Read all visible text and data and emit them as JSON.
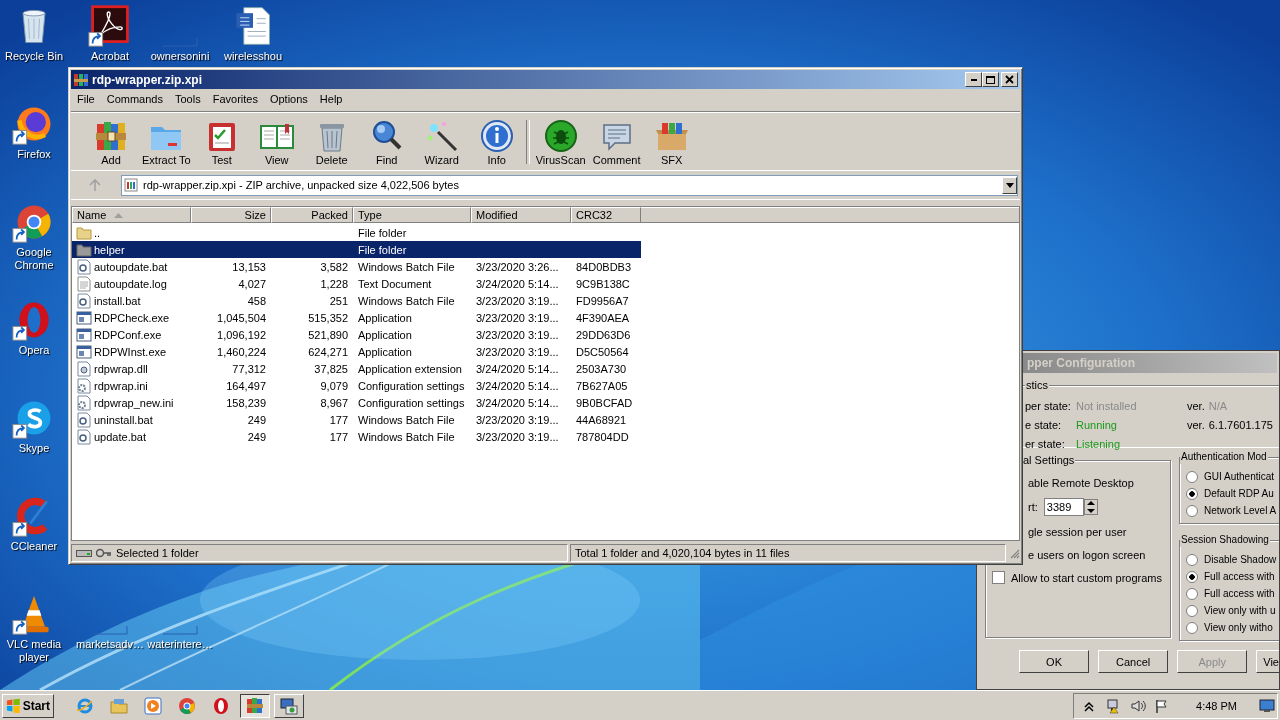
{
  "desktop": {
    "icons": [
      {
        "label": "Recycle Bin",
        "kind": "recycle",
        "shortcut": false
      },
      {
        "label": "Acrobat",
        "kind": "acrobat",
        "shortcut": true
      },
      {
        "label": "ownersonini",
        "kind": "blank",
        "shortcut": false
      },
      {
        "label": "wirelesshou",
        "kind": "word",
        "shortcut": false
      },
      {
        "label": "Firefox",
        "kind": "firefox",
        "shortcut": true
      },
      {
        "label": "Google Chrome",
        "kind": "chrome",
        "shortcut": true
      },
      {
        "label": "Opera",
        "kind": "opera",
        "shortcut": true
      },
      {
        "label": "Skype",
        "kind": "skype",
        "shortcut": true
      },
      {
        "label": "CCleaner",
        "kind": "ccleaner",
        "shortcut": true
      },
      {
        "label": "VLC media player",
        "kind": "vlc",
        "shortcut": true
      },
      {
        "label": "marketsadv…",
        "kind": "blank",
        "shortcut": false
      },
      {
        "label": "waterintere…",
        "kind": "blank",
        "shortcut": false
      }
    ]
  },
  "config_window": {
    "title": "pper Configuration",
    "diagnostics": {
      "legend": "stics",
      "rows": [
        {
          "label": "per state:",
          "value": "Not installed",
          "color": "#8a8a8a",
          "version_label": "ver.",
          "version": "N/A",
          "version_dimmed": true
        },
        {
          "label": "e state:",
          "value": "Running",
          "color": "#1a9a1a",
          "version_label": "ver.",
          "version": "6.1.7601.175",
          "version_dimmed": false
        },
        {
          "label": "er state:",
          "value": "Listening",
          "color": "#1a9a1a"
        }
      ]
    },
    "general": {
      "legend": "al Settings",
      "items": [
        {
          "kind": "text",
          "label": "able Remote Desktop"
        },
        {
          "kind": "port",
          "label": "rt:",
          "value": "3389"
        },
        {
          "kind": "text",
          "label": "gle session per user"
        },
        {
          "kind": "text",
          "label": "e users on logon screen"
        },
        {
          "kind": "checkbox",
          "label": "Allow to start custom programs",
          "checked": false
        }
      ]
    },
    "authentication": {
      "legend": "Authentication Mod",
      "options": [
        {
          "label": "GUI Authenticat",
          "selected": false
        },
        {
          "label": "Default RDP Au",
          "selected": true
        },
        {
          "label": "Network Level A",
          "selected": false
        }
      ]
    },
    "shadowing": {
      "legend": "Session Shadowing",
      "options": [
        {
          "label": "Disable Shadow",
          "selected": false
        },
        {
          "label": "Full access with",
          "selected": true
        },
        {
          "label": "Full access with",
          "selected": false
        },
        {
          "label": "View only with u",
          "selected": false
        },
        {
          "label": "View only witho",
          "selected": false
        }
      ]
    },
    "buttons": [
      {
        "label": "OK",
        "disabled": false
      },
      {
        "label": "Cancel",
        "disabled": false
      },
      {
        "label": "Apply",
        "disabled": true
      },
      {
        "label": "Vie",
        "disabled": false
      }
    ]
  },
  "archiver_window": {
    "title": "rdp-wrapper.zip.xpi",
    "menu": [
      "File",
      "Commands",
      "Tools",
      "Favorites",
      "Options",
      "Help"
    ],
    "toolbar": [
      {
        "label": "Add",
        "kind": "add",
        "separator": false
      },
      {
        "label": "Extract To",
        "kind": "extract",
        "separator": false
      },
      {
        "label": "Test",
        "kind": "test",
        "separator": false
      },
      {
        "label": "View",
        "kind": "view",
        "separator": false
      },
      {
        "label": "Delete",
        "kind": "delete",
        "separator": false
      },
      {
        "label": "Find",
        "kind": "find",
        "separator": false
      },
      {
        "label": "Wizard",
        "kind": "wizard",
        "separator": false
      },
      {
        "label": "Info",
        "kind": "info",
        "separator": false
      },
      {
        "label": "VirusScan",
        "kind": "virus",
        "separator": true
      },
      {
        "label": "Comment",
        "kind": "comment",
        "separator": false
      },
      {
        "label": "SFX",
        "kind": "sfx",
        "separator": false
      }
    ],
    "address": "rdp-wrapper.zip.xpi - ZIP archive, unpacked size 4,022,506 bytes",
    "columns": [
      {
        "label": "Name",
        "kind": "text",
        "sorted": true
      },
      {
        "label": "Size",
        "kind": "number",
        "sorted": false
      },
      {
        "label": "Packed",
        "kind": "number",
        "sorted": false
      },
      {
        "label": "Type",
        "kind": "text",
        "sorted": false
      },
      {
        "label": "Modified",
        "kind": "text",
        "sorted": false
      },
      {
        "label": "CRC32",
        "kind": "text",
        "sorted": false
      }
    ],
    "rows": [
      {
        "kind": "parent",
        "name": "..",
        "type": "File folder",
        "selected": false
      },
      {
        "kind": "folder",
        "name": "helper",
        "type": "File folder",
        "selected": true
      },
      {
        "kind": "batch",
        "name": "autoupdate.bat",
        "size": "13,153",
        "packed": "3,582",
        "type": "Windows Batch File",
        "modified": "3/23/2020 3:26...",
        "crc": "84D0BDB3",
        "selected": false
      },
      {
        "kind": "text",
        "name": "autoupdate.log",
        "size": "4,027",
        "packed": "1,228",
        "type": "Text Document",
        "modified": "3/24/2020 5:14...",
        "crc": "9C9B138C",
        "selected": false
      },
      {
        "kind": "batch",
        "name": "install.bat",
        "size": "458",
        "packed": "251",
        "type": "Windows Batch File",
        "modified": "3/23/2020 3:19...",
        "crc": "FD9956A7",
        "selected": false
      },
      {
        "kind": "exe",
        "name": "RDPCheck.exe",
        "size": "1,045,504",
        "packed": "515,352",
        "type": "Application",
        "modified": "3/23/2020 3:19...",
        "crc": "4F390AEA",
        "selected": false
      },
      {
        "kind": "exe",
        "name": "RDPConf.exe",
        "size": "1,096,192",
        "packed": "521,890",
        "type": "Application",
        "modified": "3/23/2020 3:19...",
        "crc": "29DD63D6",
        "selected": false
      },
      {
        "kind": "exe",
        "name": "RDPWInst.exe",
        "size": "1,460,224",
        "packed": "624,271",
        "type": "Application",
        "modified": "3/23/2020 3:19...",
        "crc": "D5C50564",
        "selected": false
      },
      {
        "kind": "dll",
        "name": "rdpwrap.dll",
        "size": "77,312",
        "packed": "37,825",
        "type": "Application extension",
        "modified": "3/24/2020 5:14...",
        "crc": "2503A730",
        "selected": false
      },
      {
        "kind": "ini",
        "name": "rdpwrap.ini",
        "size": "164,497",
        "packed": "9,079",
        "type": "Configuration settings",
        "modified": "3/24/2020 5:14...",
        "crc": "7B627A05",
        "selected": false
      },
      {
        "kind": "ini",
        "name": "rdpwrap_new.ini",
        "size": "158,239",
        "packed": "8,967",
        "type": "Configuration settings",
        "modified": "3/24/2020 5:14...",
        "crc": "9B0BCFAD",
        "selected": false
      },
      {
        "kind": "batch",
        "name": "uninstall.bat",
        "size": "249",
        "packed": "177",
        "type": "Windows Batch File",
        "modified": "3/23/2020 3:19...",
        "crc": "44A68921",
        "selected": false
      },
      {
        "kind": "batch",
        "name": "update.bat",
        "size": "249",
        "packed": "177",
        "type": "Windows Batch File",
        "modified": "3/23/2020 3:19...",
        "crc": "787804DD",
        "selected": false
      }
    ],
    "status": {
      "selection": "Selected 1 folder",
      "total": "Total 1 folder and 4,020,104 bytes in 11 files"
    }
  },
  "taskbar": {
    "start": "Start",
    "apps": [
      {
        "kind": "ie",
        "open": false,
        "active": false
      },
      {
        "kind": "explorer",
        "open": false,
        "active": false
      },
      {
        "kind": "media",
        "open": false,
        "active": false
      },
      {
        "kind": "chrome",
        "open": false,
        "active": false
      },
      {
        "kind": "opera",
        "open": false,
        "active": false
      },
      {
        "kind": "archiver",
        "open": true,
        "active": true
      },
      {
        "kind": "config",
        "open": true,
        "active": false
      }
    ],
    "tray": [
      {
        "kind": "chevron"
      },
      {
        "kind": "network"
      },
      {
        "kind": "volume"
      },
      {
        "kind": "flag"
      }
    ],
    "clock": "4:48 PM"
  }
}
